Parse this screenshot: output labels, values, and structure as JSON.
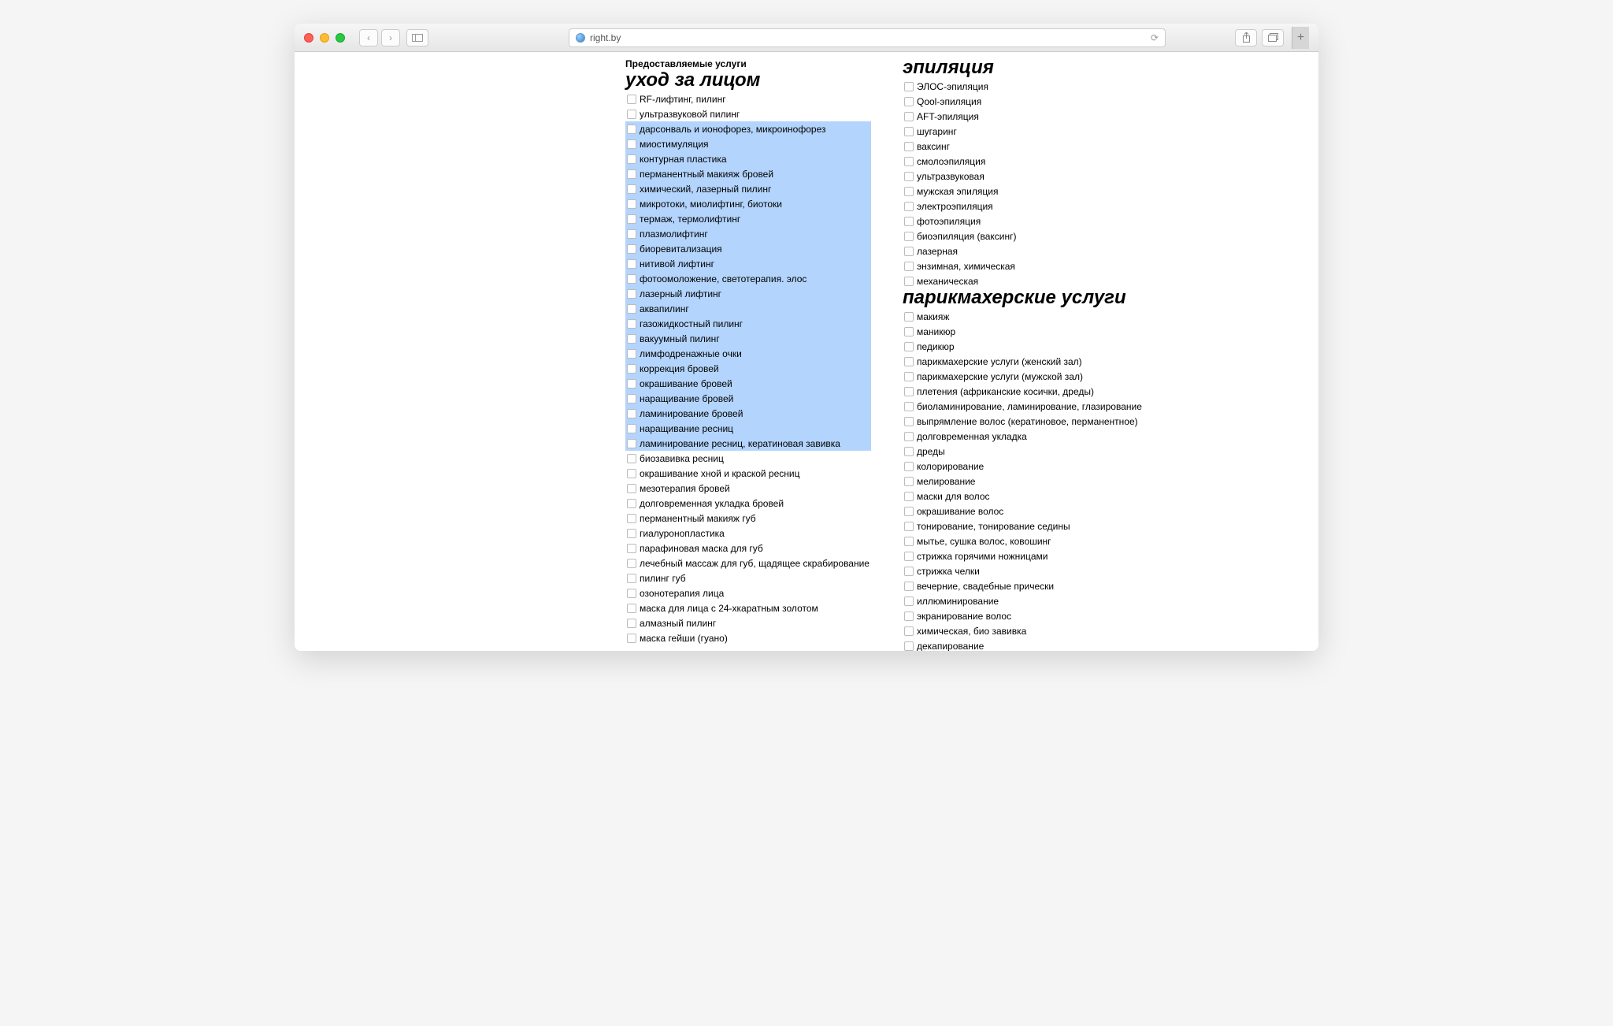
{
  "browser": {
    "url": "right.by"
  },
  "section_title": "Предоставляемые услуги",
  "columns": [
    {
      "categories": [
        {
          "title": "уход за лицом",
          "items": [
            {
              "label": "RF-лифтинг, пилинг",
              "selected": false
            },
            {
              "label": "ультразвуковой пилинг",
              "selected": false
            },
            {
              "label": "дарсонваль и ионофорез, микроинофорез",
              "selected": true
            },
            {
              "label": "миостимуляция",
              "selected": true
            },
            {
              "label": "контурная пластика",
              "selected": true
            },
            {
              "label": "перманентный макияж бровей",
              "selected": true
            },
            {
              "label": "химический, лазерный пилинг",
              "selected": true
            },
            {
              "label": "микротоки, миолифтинг, биотоки",
              "selected": true
            },
            {
              "label": "термаж, термолифтинг",
              "selected": true
            },
            {
              "label": "плазмолифтинг",
              "selected": true
            },
            {
              "label": "биоревитализация",
              "selected": true
            },
            {
              "label": "нитивой лифтинг",
              "selected": true
            },
            {
              "label": "фотоомоложение, светотерапия. элос",
              "selected": true
            },
            {
              "label": "лазерный лифтинг",
              "selected": true
            },
            {
              "label": "аквапилинг",
              "selected": true
            },
            {
              "label": "газожидкостный пилинг",
              "selected": true
            },
            {
              "label": "вакуумный пилинг",
              "selected": true
            },
            {
              "label": "лимфодренажные очки",
              "selected": true
            },
            {
              "label": "коррекция бровей",
              "selected": true
            },
            {
              "label": "окрашивание бровей",
              "selected": true
            },
            {
              "label": "наращивание бровей",
              "selected": true
            },
            {
              "label": "ламинирование бровей",
              "selected": true
            },
            {
              "label": "наращивание ресниц",
              "selected": true
            },
            {
              "label": "ламинирование ресниц, кератиновая завивка",
              "selected": true
            },
            {
              "label": "биозавивка ресниц",
              "selected": false
            },
            {
              "label": "окрашивание хной и краской ресниц",
              "selected": false
            },
            {
              "label": "мезотерапия бровей",
              "selected": false
            },
            {
              "label": "долговременная укладка бровей",
              "selected": false
            },
            {
              "label": "перманентный макияж губ",
              "selected": false
            },
            {
              "label": "гиалуронопластика",
              "selected": false
            },
            {
              "label": "парафиновая маска для губ",
              "selected": false
            },
            {
              "label": "лечебный массаж для губ, щадящее скрабирование",
              "selected": false
            },
            {
              "label": "пилинг губ",
              "selected": false
            },
            {
              "label": "озонотерапия лица",
              "selected": false
            },
            {
              "label": "маска для лица с 24-хкаратным золотом",
              "selected": false
            },
            {
              "label": "алмазный пилинг",
              "selected": false
            },
            {
              "label": "маска гейши (гуано)",
              "selected": false
            }
          ]
        }
      ]
    },
    {
      "categories": [
        {
          "title": "эпиляция",
          "items": [
            {
              "label": "ЭЛОС-эпиляция",
              "selected": false
            },
            {
              "label": "Qool-эпиляция",
              "selected": false
            },
            {
              "label": "AFT-эпиляция",
              "selected": false
            },
            {
              "label": "шугаринг",
              "selected": false
            },
            {
              "label": "ваксинг",
              "selected": false
            },
            {
              "label": "смолоэпиляция",
              "selected": false
            },
            {
              "label": "ультразвуковая",
              "selected": false
            },
            {
              "label": "мужская эпиляция",
              "selected": false
            },
            {
              "label": "электроэпиляция",
              "selected": false
            },
            {
              "label": "фотоэпиляция",
              "selected": false
            },
            {
              "label": "биоэпиляция (ваксинг)",
              "selected": false
            },
            {
              "label": "лазерная",
              "selected": false
            },
            {
              "label": "энзимная, химическая",
              "selected": false
            },
            {
              "label": "механическая",
              "selected": false
            }
          ]
        },
        {
          "title": "парикмахерские услуги",
          "items": [
            {
              "label": "макияж",
              "selected": false
            },
            {
              "label": "маникюр",
              "selected": false
            },
            {
              "label": "педикюр",
              "selected": false
            },
            {
              "label": "парикмахерские услуги (женский зал)",
              "selected": false
            },
            {
              "label": "парикмахерские услуги (мужской зал)",
              "selected": false
            },
            {
              "label": "плетения (африканские косички, дреды)",
              "selected": false
            },
            {
              "label": "биоламинирование, ламинирование, глазирование",
              "selected": false
            },
            {
              "label": "выпрямление волос (кератиновое, перманентное)",
              "selected": false
            },
            {
              "label": "долговременная укладка",
              "selected": false
            },
            {
              "label": "дреды",
              "selected": false
            },
            {
              "label": "колорирование",
              "selected": false
            },
            {
              "label": "мелирование",
              "selected": false
            },
            {
              "label": "маски для волос",
              "selected": false
            },
            {
              "label": "окрашивание волос",
              "selected": false
            },
            {
              "label": "тонирование, тонирование седины",
              "selected": false
            },
            {
              "label": "мытье, сушка волос, ковошинг",
              "selected": false
            },
            {
              "label": "стрижка горячими ножницами",
              "selected": false
            },
            {
              "label": "стрижка челки",
              "selected": false
            },
            {
              "label": "вечерние, свадебные прически",
              "selected": false
            },
            {
              "label": "иллюминирование",
              "selected": false
            },
            {
              "label": "экранирование волос",
              "selected": false
            },
            {
              "label": "химическая, био завивка",
              "selected": false
            },
            {
              "label": "декапирование",
              "selected": false
            }
          ]
        }
      ]
    }
  ]
}
